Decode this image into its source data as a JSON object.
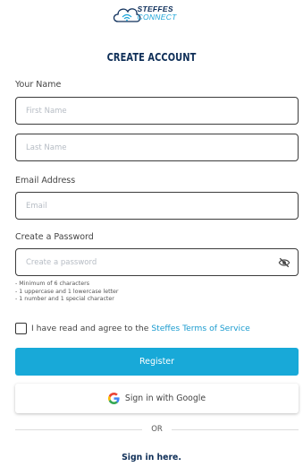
{
  "brand": {
    "line1": "STEFFES",
    "line2": "CONNECT"
  },
  "title": "CREATE ACCOUNT",
  "name_section": {
    "label": "Your Name",
    "first_placeholder": "First Name",
    "last_placeholder": "Last Name"
  },
  "email_section": {
    "label": "Email Address",
    "placeholder": "Email"
  },
  "password_section": {
    "label": "Create a Password",
    "placeholder": "Create a password",
    "hints": [
      "- Minimum of 6 characters",
      "- 1 uppercase and 1 lowercase letter",
      "- 1 number and 1 special character"
    ]
  },
  "terms": {
    "prefix": "I have read and agree to the ",
    "link": "Steffes Terms of Service"
  },
  "register_label": "Register",
  "google_label": "Sign in with Google",
  "or_label": "OR",
  "signin_label": "Sign in here.",
  "colors": {
    "accent": "#18a9d8",
    "navy": "#0f2f58",
    "link": "#1a9bcf"
  }
}
